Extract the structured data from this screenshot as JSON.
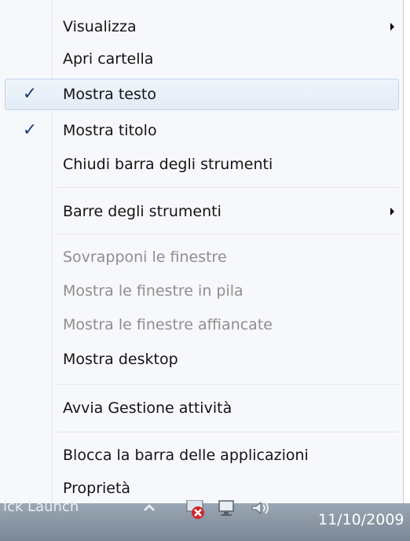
{
  "menu": {
    "items": [
      {
        "label": "Visualizza",
        "checked": false,
        "submenu": true,
        "disabled": false
      },
      {
        "label": "Apri cartella",
        "checked": false,
        "submenu": false,
        "disabled": false
      },
      {
        "label": "Mostra testo",
        "checked": true,
        "submenu": false,
        "disabled": false,
        "highlighted": true
      },
      {
        "label": "Mostra titolo",
        "checked": true,
        "submenu": false,
        "disabled": false
      },
      {
        "label": "Chiudi barra degli strumenti",
        "checked": false,
        "submenu": false,
        "disabled": false
      },
      {
        "label": "Barre degli strumenti",
        "checked": false,
        "submenu": true,
        "disabled": false
      },
      {
        "label": "Sovrapponi le finestre",
        "checked": false,
        "submenu": false,
        "disabled": true
      },
      {
        "label": "Mostra le finestre in pila",
        "checked": false,
        "submenu": false,
        "disabled": true
      },
      {
        "label": "Mostra le finestre affiancate",
        "checked": false,
        "submenu": false,
        "disabled": true
      },
      {
        "label": "Mostra desktop",
        "checked": false,
        "submenu": false,
        "disabled": false
      },
      {
        "label": "Avvia Gestione attività",
        "checked": false,
        "submenu": false,
        "disabled": false
      },
      {
        "label": "Blocca la barra delle applicazioni",
        "checked": false,
        "submenu": false,
        "disabled": false
      },
      {
        "label": "Proprietà",
        "checked": false,
        "submenu": false,
        "disabled": false
      }
    ],
    "check_glyph": "✓"
  },
  "taskbar": {
    "partial_text": "ick Launch",
    "tray_icons": [
      "chevron-up-icon",
      "network-error-icon",
      "monitor-icon",
      "speaker-icon"
    ],
    "clock_date": "11/10/2009"
  }
}
